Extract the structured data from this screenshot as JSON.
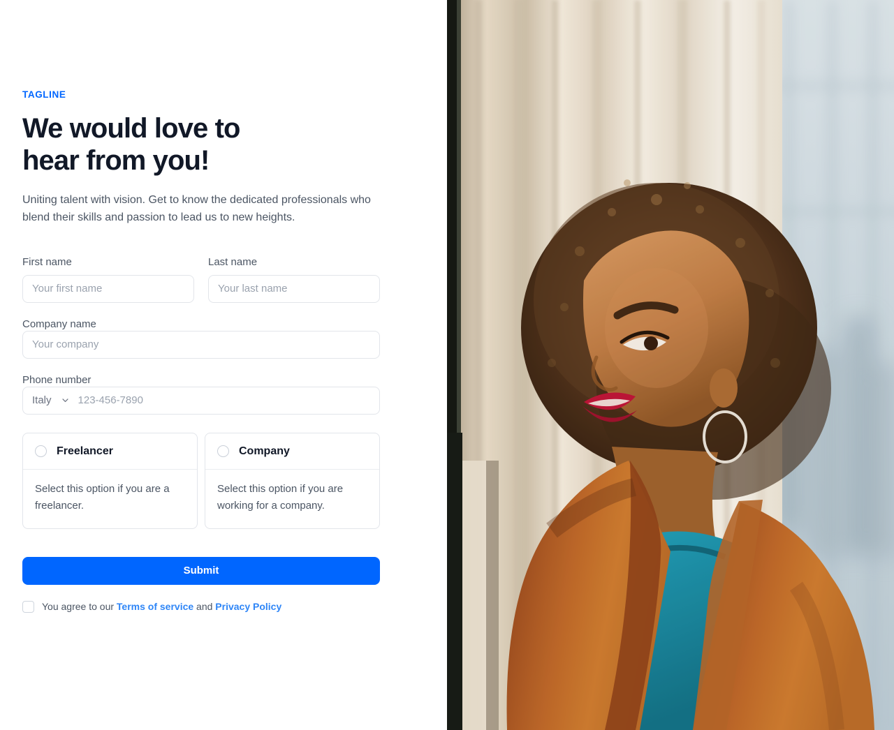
{
  "hero": {
    "tagline": "TAGLINE",
    "headline": "We would love to\nhear from you!",
    "subtitle": "Uniting talent with vision. Get to know the dedicated professionals who blend their skills and passion to lead us to new heights."
  },
  "form": {
    "first_name": {
      "label": "First name",
      "placeholder": "Your first name",
      "value": ""
    },
    "last_name": {
      "label": "Last name",
      "placeholder": "Your last name",
      "value": ""
    },
    "company_name": {
      "label": "Company name",
      "placeholder": "Your company",
      "value": ""
    },
    "phone": {
      "label": "Phone number",
      "country_selected": "Italy",
      "country_options": [
        "Italy"
      ],
      "placeholder": "123-456-7890",
      "value": ""
    },
    "options": [
      {
        "title": "Freelancer",
        "description": "Select this option if you are a freelancer.",
        "selected": false
      },
      {
        "title": "Company",
        "description": "Select this option if you are working for a company.",
        "selected": false
      }
    ],
    "submit_label": "Submit",
    "terms": {
      "checked": false,
      "prefix": "You agree to our ",
      "terms_link": "Terms of service",
      "conjunction": " and ",
      "privacy_link": "Privacy Policy"
    }
  },
  "photo": {
    "description": "Woman with afro hair in rust-orange blazer and teal top looking up beside a window with sheer curtains",
    "colors": {
      "curtain_light": "#f2ece2",
      "curtain_shadow": "#cdc3b2",
      "window_glass": "#cfdde5",
      "dark_edge": "#0d1410",
      "blazer": "#c2682a",
      "blazer_shadow": "#7d3a18",
      "top_teal": "#11859f",
      "skin": "#c07b45",
      "hair": "#5c3a22",
      "lips": "#c01030"
    }
  },
  "theme": {
    "accent": "#0066ff",
    "link": "#2f86f7",
    "heading": "#111827",
    "body_text": "#4b5563",
    "placeholder": "#9aa2ae",
    "border": "#e2e5ea"
  }
}
